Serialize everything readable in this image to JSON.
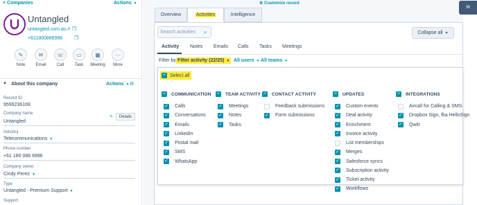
{
  "sidebar": {
    "back_link": "< Companies",
    "actions_label": "Actions",
    "company_name": "Untangled",
    "domain": "untangled.com.au",
    "phone": "+611800886996",
    "quick_actions": [
      {
        "label": "Note",
        "icon": "note-icon"
      },
      {
        "label": "Email",
        "icon": "email-icon"
      },
      {
        "label": "Call",
        "icon": "phone-icon"
      },
      {
        "label": "Task",
        "icon": "task-icon"
      },
      {
        "label": "Meeting",
        "icon": "calendar-icon"
      },
      {
        "label": "More",
        "icon": "more-icon"
      }
    ],
    "about": {
      "title": "About this company",
      "actions_label": "Actions",
      "fields": [
        {
          "label": "Record ID",
          "value": "9599236169"
        },
        {
          "label": "Company name",
          "value": "Untangled"
        },
        {
          "label": "Industry",
          "value": "Telecommunications"
        },
        {
          "label": "Phone number",
          "value": "+61 180 088 6996"
        },
        {
          "label": "Company owner",
          "value": "Cindy Perez"
        },
        {
          "label": "Type",
          "value": "Untangled - Premium Support"
        },
        {
          "label": "Support",
          "value": ""
        }
      ],
      "details_button": "Details"
    }
  },
  "main": {
    "customize_label": "Customize record",
    "expand_icon": "double-chevron-right-icon",
    "tabs": [
      {
        "label": "Overview"
      },
      {
        "label": "Activities"
      },
      {
        "label": "Intelligence"
      }
    ],
    "search_placeholder": "Search activities",
    "collapse_label": "Collapse all",
    "subtabs": [
      "Activity",
      "Notes",
      "Emails",
      "Calls",
      "Tasks",
      "Meetings"
    ],
    "filter": {
      "prefix": "Filter by:",
      "activity": "Filter activity (22/25)",
      "users": "All users",
      "teams": "All teams"
    },
    "select_all": "Select all",
    "groups": [
      {
        "title": "COMMUNICATION",
        "items": [
          {
            "label": "Calls",
            "checked": true
          },
          {
            "label": "Conversations",
            "checked": true
          },
          {
            "label": "Emails",
            "checked": true
          },
          {
            "label": "LinkedIn",
            "checked": true
          },
          {
            "label": "Postal mail",
            "checked": true
          },
          {
            "label": "SMS",
            "checked": true
          },
          {
            "label": "WhatsApp",
            "checked": true
          }
        ]
      },
      {
        "title": "TEAM ACTIVITY",
        "items": [
          {
            "label": "Meetings",
            "checked": true
          },
          {
            "label": "Notes",
            "checked": true
          },
          {
            "label": "Tasks",
            "checked": true
          }
        ]
      },
      {
        "title": "CONTACT ACTIVITY",
        "items": [
          {
            "label": "Feedback submissions",
            "checked": false
          },
          {
            "label": "Form submissions",
            "checked": true
          }
        ]
      },
      {
        "title": "UPDATES",
        "items": [
          {
            "label": "Custom events",
            "checked": true
          },
          {
            "label": "Deal activity",
            "checked": true
          },
          {
            "label": "Enrichment",
            "checked": true
          },
          {
            "label": "Invoice activity",
            "checked": true
          },
          {
            "label": "List memberships",
            "checked": false
          },
          {
            "label": "Merges",
            "checked": true
          },
          {
            "label": "Salesforce syncs",
            "checked": true
          },
          {
            "label": "Subscription activity",
            "checked": true
          },
          {
            "label": "Ticket activity",
            "checked": true
          },
          {
            "label": "Workflows",
            "checked": true
          }
        ]
      },
      {
        "title": "INTEGRATIONS",
        "items": [
          {
            "label": "Aircall for Calling & SMS",
            "checked": false
          },
          {
            "label": "Dropbox Sign, fka HelloSign",
            "checked": true
          },
          {
            "label": "Qwilr",
            "checked": true
          }
        ]
      }
    ],
    "colors": {
      "accent": "#0091ae",
      "highlight": "#ffeb3b",
      "text": "#33475b",
      "expand_button": "#425b76"
    }
  }
}
